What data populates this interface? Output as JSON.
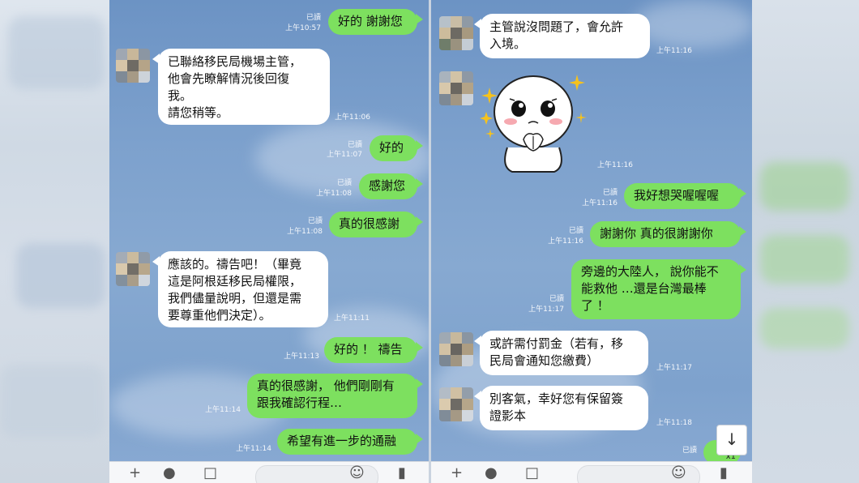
{
  "left_chat": {
    "messages": [
      {
        "text": "好的 謝謝您",
        "read": "已讀",
        "time": "上午10:57"
      },
      {
        "text": "已聯絡移民局機場主管，\n他會先瞭解情況後回復\n我。\n請您稍等。",
        "time": "上午11:06"
      },
      {
        "text": "好的",
        "read": "已讀",
        "time": "上午11:07"
      },
      {
        "text": "感謝您",
        "read": "已讀",
        "time": "上午11:08"
      },
      {
        "text": "真的很感謝",
        "read": "已讀",
        "time": "上午11:08"
      },
      {
        "text": "應該的。禱告吧！（畢竟\n這是阿根廷移民局權限，\n我們儘量說明，但還是需\n要尊重他們決定）。",
        "time": "上午11:11"
      },
      {
        "text": "好的 ！ 禱告",
        "time": "上午11:13"
      },
      {
        "text": "真的很感謝， 他們剛剛有\n跟我確認行程…",
        "time": "上午11:14"
      },
      {
        "text": "希望有進一步的通融",
        "time": "上午11:14"
      }
    ]
  },
  "right_chat": {
    "messages": [
      {
        "text": "主管說沒問題了，會允許\n入境。",
        "time": "上午11:16"
      },
      {
        "sticker": "pleading-face-sticker",
        "time": "上午11:16"
      },
      {
        "text": "我好想哭喔喔喔",
        "read": "已讀",
        "time": "上午11:16"
      },
      {
        "text": "謝謝你  真的很謝謝你",
        "read": "已讀",
        "time": "上午11:16"
      },
      {
        "text": "旁邊的大陸人， 說你能不\n能救他 …還是台灣最棒\n了 ！",
        "read": "已讀",
        "time": "上午11:17"
      },
      {
        "text": "或許需付罰金（若有，移\n民局會通知您繳費）",
        "time": "上午11:17"
      },
      {
        "text": "別客氣，幸好您有保留簽\n證影本",
        "time": "上午11:18"
      },
      {
        "read": "已讀"
      }
    ],
    "badge": "x1"
  },
  "colors": {
    "outgoing_bubble": "#7de05f",
    "incoming_bubble": "#ffffff",
    "background": "#7da1cd"
  },
  "icons": [
    "plus-icon",
    "camera-icon",
    "image-icon",
    "emoji-icon",
    "mic-icon",
    "chevron-down-icon"
  ]
}
